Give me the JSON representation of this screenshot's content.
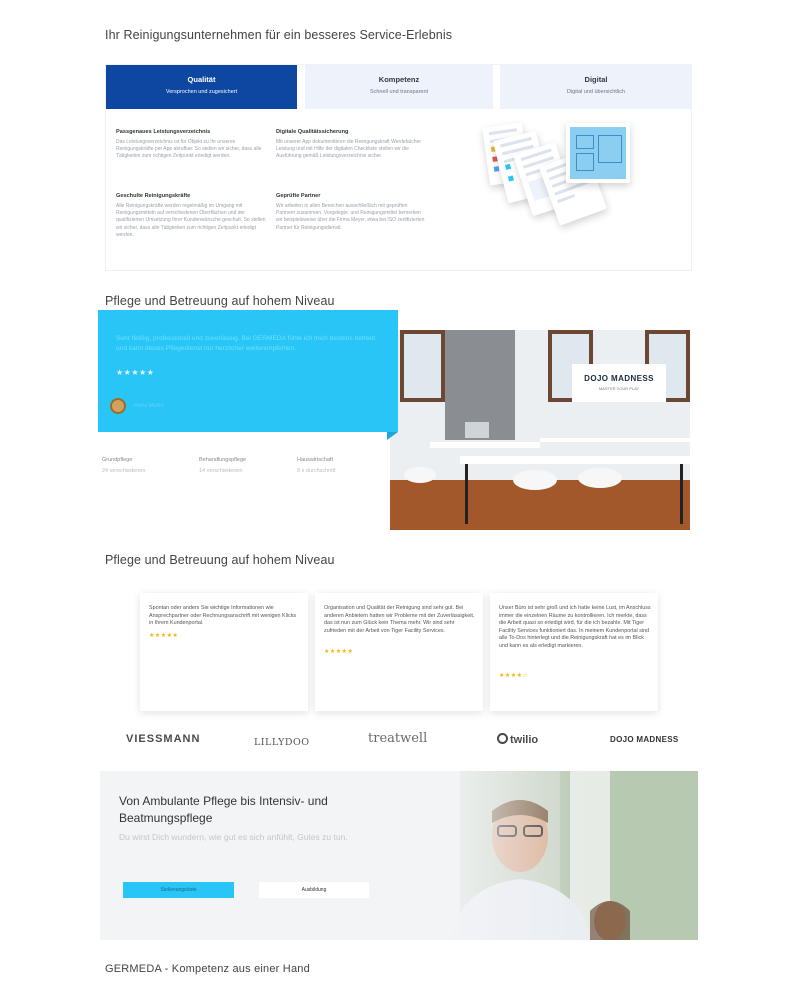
{
  "section1": {
    "title": "Ihr Reinigungsunternehmen für ein besseres Service-Erlebnis",
    "tabs": [
      {
        "title": "Qualität",
        "subtitle": "Versprochen und zugesichert"
      },
      {
        "title": "Kompetenz",
        "subtitle": "Schnell und transparent"
      },
      {
        "title": "Digital",
        "subtitle": "Digital und übersichtlich"
      }
    ],
    "features": [
      {
        "title": "Passgenaues Leistungsverzeichnis",
        "text": "Das Leistungsverzeichnis ist für Objekt zu Ihr unseres Reinigungskräfte per App abrufbar. So stellen wir sicher, dass alle Tätigkeiten zum richtigen Zeitpunkt erledigt werden."
      },
      {
        "title": "Digitale Qualitätssicherung",
        "text": "Mit unserer App dokumentieren die Reinigungskraft Werdebücher Leistung und mit Hilfe der digitalen Checkliste stellen wir die Ausführung gemäß Leistungsverzeichnis sicher."
      },
      {
        "title": "Geschulte Reinigungskräfte",
        "text": "Alle Reinigungskräfte werden regelmäßig im Umgang mit Reinigungsmitteln auf verschiedenen Oberflächen und der qualifizierten Umsetzung Ihrer Kundenwünsche geschult. So stellen wir sicher, dass alle Tätigkeiten zum richtigen Zeitpunkt erledigt werden."
      },
      {
        "title": "Geprüfte Partner",
        "text": "Wir arbeiten in allen Bereichen ausschließlich mit geprüften Partnern zusammen. Vorgelegte, und Reinigungsmittel bemerken wir beispielsweise über die Firma Meyer, etwa bei ISO zertifizierten Partner für Reinigungsdienstl."
      }
    ]
  },
  "section2": {
    "title": "Pflege und Betreuung auf hohem Niveau",
    "quote": "Sehr fleißig, professionell und zuverlässig. Bei GERMEDA fühle ich mich bestens betreut und kann dieses Pflegedienst nur herzlicher weiterempfehlen.",
    "stars": "★★★★★",
    "author": "Petra Müller",
    "stats": [
      {
        "label": "Grundpflege",
        "value": "24 verschiedenen"
      },
      {
        "label": "Behandlungspflege",
        "value": "14 verschiedenen"
      },
      {
        "label": "Hauswirtschaft",
        "value": "9 x durchschnitt"
      }
    ],
    "sign_title": "DOJO MADNESS",
    "sign_sub": "MASTER YOUR PLAY"
  },
  "section3": {
    "title": "Pflege und Betreuung auf hohem Niveau",
    "reviews": [
      {
        "text": "Spontan oder anders Sie wichtige Informationen wie Ansprechpartner oder Rechnungsanschrift mit wenigen Klicks in Ihrem Kundenportal.",
        "stars": "★★★★★"
      },
      {
        "text": "Organisation und Qualität der Reinigung sind sehr gut. Bei anderen Anbietern hatten wir Probleme mit der Zuverlässigkeit, das ist nun zum Glück kein Thema mehr. Wir sind sehr zufrieden mit der Arbeit von Tiger Facility Services.",
        "stars": "★★★★★"
      },
      {
        "text": "Unser Büro ist sehr groß und ich hatte keine Lust, im Anschluss immer die einzelnen Räume zu kontrollieren. Ich merkte, dass die Arbeit quasi so erledigt wird, für die ich bezahle. Mit Tiger Facility Services funktioniert das. In meinem Kundenportal sind alle To-Dos hinterlegt und die Reinigungskraft hat es im Blick und kann es als erledigt markieren.",
        "stars": "★★★★☆"
      }
    ],
    "logos": [
      "VIESSMANN",
      "LILLYDOO",
      "treatwell",
      "twilio",
      "DOJO MADNESS"
    ]
  },
  "hero": {
    "title": "Von Ambulante Pflege bis Intensiv- und Beatmungspflege",
    "subtitle": "Du wirst Dich wundern, wie gut es sich anfühlt, Gutes zu tun.",
    "primary_button": "Stellenangebote",
    "secondary_button": "Ausbildung"
  },
  "footer": {
    "title": "GERMEDA - Kompetenz aus einer Hand"
  },
  "colors": {
    "accent_blue": "#0d47a1",
    "cyan": "#29c5f6",
    "star": "#f4b400"
  }
}
